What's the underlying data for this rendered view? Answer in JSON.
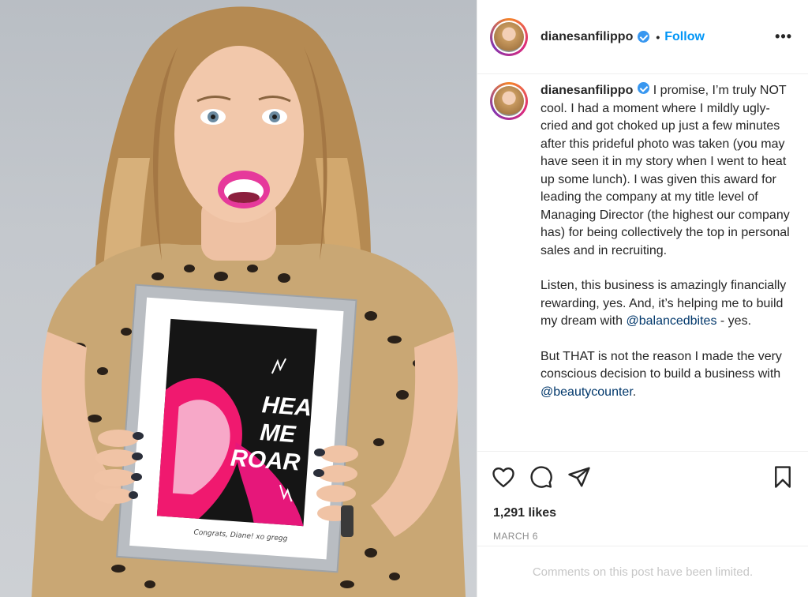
{
  "header": {
    "username": "dianesanfilippo",
    "separator": "•",
    "follow_label": "Follow",
    "more_label": "•••"
  },
  "photo": {
    "art_title_lines": [
      "HEAR",
      "ME",
      "ROAR"
    ],
    "art_signature": "Congrats, Diane! xo gregg"
  },
  "caption": {
    "username": "dianesanfilippo",
    "p1": " I promise, I’m truly NOT cool. I had a moment where I mildly ugly-cried and got choked up just a few minutes after this prideful photo was taken (you may have seen it in my story when I went to heat up some lunch). I was given this award for leading the company at my title level of Managing Director (the highest our company has) for being collectively the top in personal sales and in recruiting.",
    "p2_before": "Listen, this business is amazingly financially rewarding, yes. And, it’s helping me to build my dream with ",
    "p2_mention": "@balancedbites",
    "p2_after": " - yes.",
    "p3_before": "But THAT is not the reason I made the very conscious decision to build a business with ",
    "p3_mention": "@beautycounter",
    "p3_after": "."
  },
  "actions": {
    "icons": [
      "heart-icon",
      "comment-icon",
      "share-icon",
      "bookmark-icon"
    ]
  },
  "likes": "1,291 likes",
  "date": "MARCH 6",
  "comments_notice": "Comments on this post have been limited.",
  "colors": {
    "link": "#0095f6",
    "mention": "#00376b",
    "muted": "#8e8e8e",
    "verified": "#3897f0"
  }
}
